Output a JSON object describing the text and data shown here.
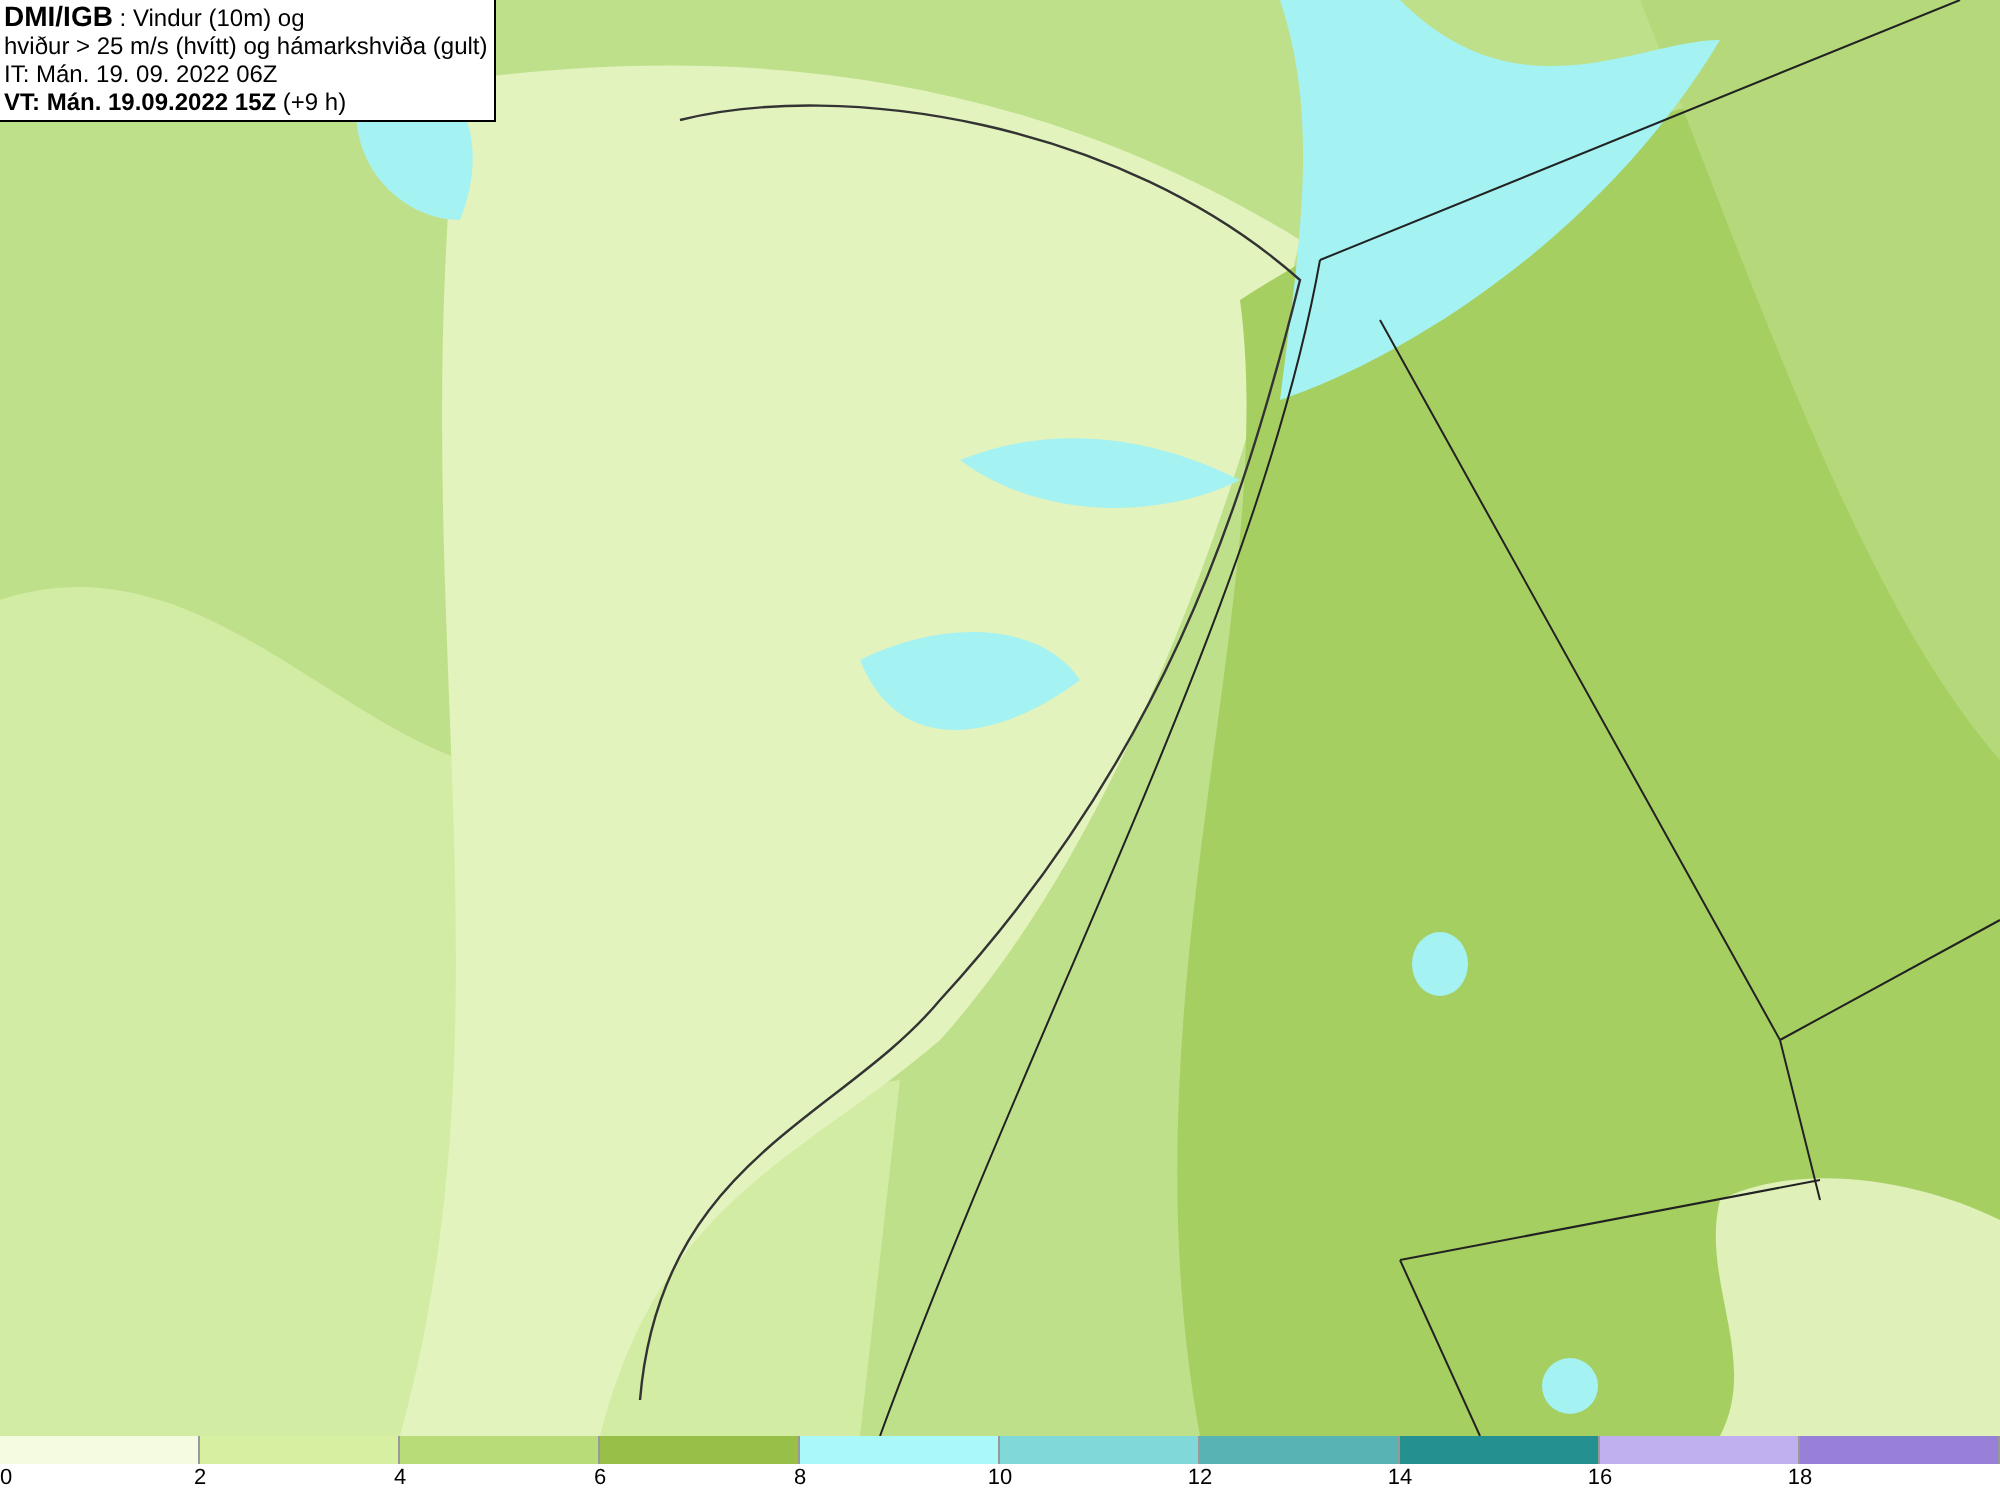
{
  "legend": {
    "lines": [
      "**DMI/IGB** : Vindur (10m) og",
      "hviður > 25 m/s (hvítt) og hámarkshviða (gult)",
      "IT: Mán. 19. 09. 2022 06Z",
      "**VT: Mán. 19.09.2022 15Z** (+9 h)"
    ]
  },
  "colorbar": {
    "segments": [
      {
        "color": "#f5fbe0"
      },
      {
        "color": "#d6efa0"
      },
      {
        "color": "#b8dc78"
      },
      {
        "color": "#98c048"
      },
      {
        "color": "#aaf8f8"
      },
      {
        "color": "#80d8d8"
      },
      {
        "color": "#58b4b4"
      },
      {
        "color": "#259090"
      },
      {
        "color": "#c0b0f0"
      },
      {
        "color": "#9880d8"
      }
    ],
    "ticks": [
      "0",
      "2",
      "4",
      "6",
      "8",
      "10",
      "12",
      "14",
      "16",
      "18"
    ]
  }
}
